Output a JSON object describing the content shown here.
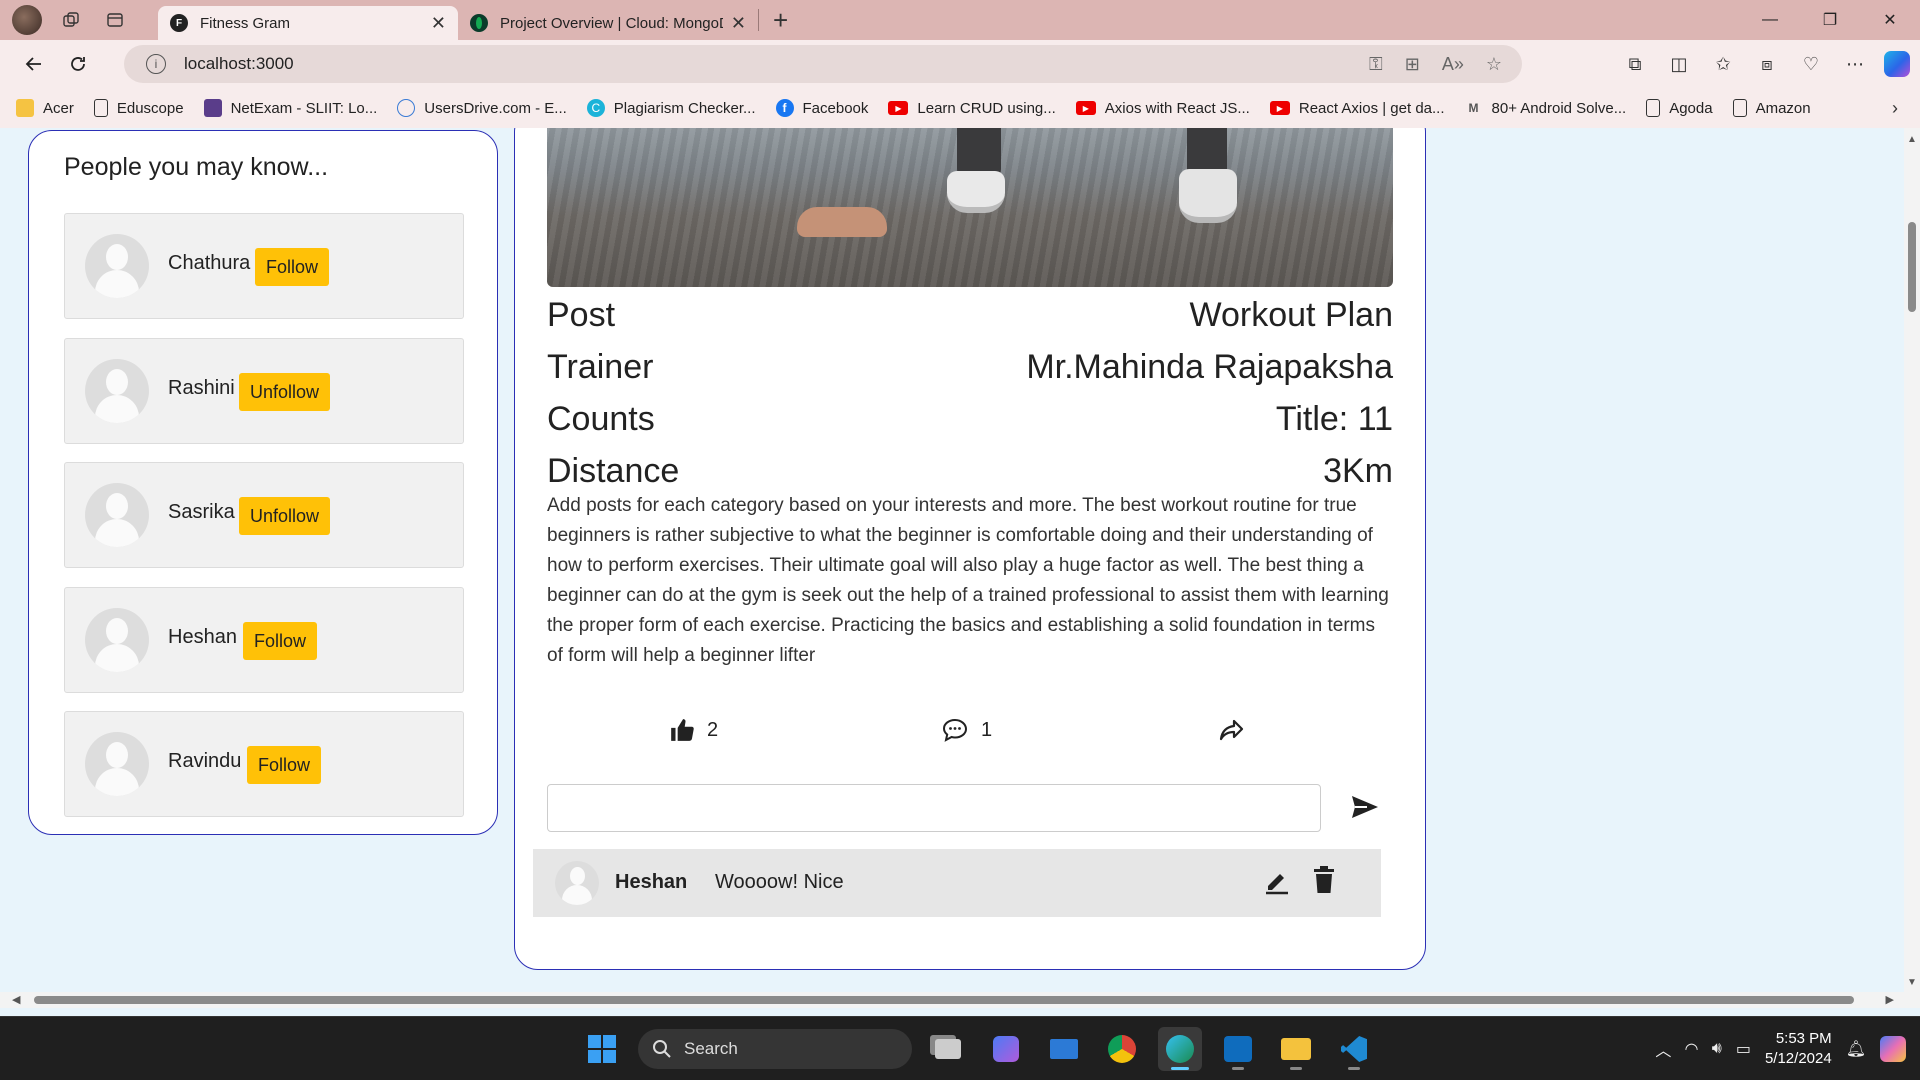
{
  "browser": {
    "tabs": [
      {
        "title": "Fitness Gram",
        "active": true
      },
      {
        "title": "Project Overview | Cloud: MongoDB",
        "active": false
      }
    ],
    "url": "localhost:3000",
    "bookmarks": [
      {
        "label": "Acer",
        "icon": "folder-icon"
      },
      {
        "label": "Eduscope",
        "icon": "page-icon"
      },
      {
        "label": "NetExam - SLIIT: Lo...",
        "icon": "netexam-icon"
      },
      {
        "label": "UsersDrive.com - E...",
        "icon": "drive-icon"
      },
      {
        "label": "Plagiarism Checker...",
        "icon": "plagiarism-icon"
      },
      {
        "label": "Facebook",
        "icon": "facebook-icon"
      },
      {
        "label": "Learn CRUD using...",
        "icon": "youtube-icon"
      },
      {
        "label": "Axios with React JS...",
        "icon": "youtube-icon"
      },
      {
        "label": "React Axios | get da...",
        "icon": "youtube-icon"
      },
      {
        "label": "80+ Android Solve...",
        "icon": "gmail-icon"
      },
      {
        "label": "Agoda",
        "icon": "page-icon"
      },
      {
        "label": "Amazon",
        "icon": "page-icon"
      }
    ]
  },
  "sidebar": {
    "title": "People you may know...",
    "people": [
      {
        "name": "Chathura",
        "action": "Follow"
      },
      {
        "name": "Rashini",
        "action": "Unfollow"
      },
      {
        "name": "Sasrika",
        "action": "Unfollow"
      },
      {
        "name": "Heshan",
        "action": "Follow"
      },
      {
        "name": "Ravindu",
        "action": "Follow"
      }
    ]
  },
  "post": {
    "rows": [
      {
        "label": "Post",
        "value": "Workout Plan"
      },
      {
        "label": "Trainer",
        "value": "Mr.Mahinda Rajapaksha"
      },
      {
        "label": "Counts",
        "value": "Title: 11"
      },
      {
        "label": "Distance",
        "value": "3Km"
      }
    ],
    "description": "Add posts for each category based on your interests and more. The best workout routine for true beginners is rather subjective to what the beginner is comfortable doing and their understanding of how to perform exercises. Their ultimate goal will also play a huge factor as well. The best thing a beginner can do at the gym is seek out the help of a trained professional to assist them with learning the proper form of each exercise. Practicing the basics and establishing a solid foundation in terms of form will help a beginner lifter",
    "likes": "2",
    "comments_count": "1",
    "comment_input_value": "",
    "comments": [
      {
        "user": "Heshan",
        "text": "Woooow! Nice"
      }
    ]
  },
  "taskbar": {
    "search_label": "Search",
    "time": "5:53 PM",
    "date": "5/12/2024"
  },
  "colors": {
    "accent_border": "#2b2fb5",
    "follow_button": "#ffc107",
    "page_background": "#e8f4fb"
  }
}
